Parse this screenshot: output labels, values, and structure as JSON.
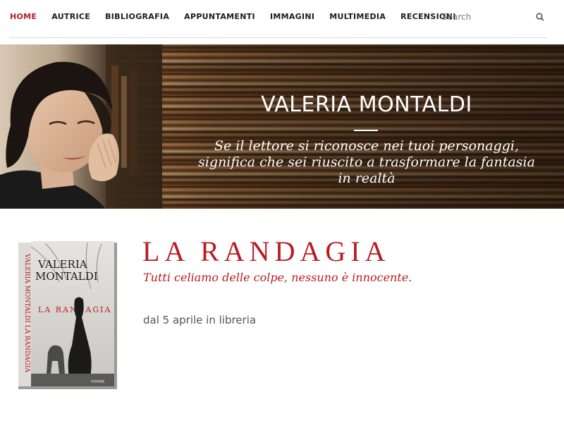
{
  "nav": {
    "items": [
      {
        "label": "HOME",
        "active": true
      },
      {
        "label": "AUTRICE",
        "active": false
      },
      {
        "label": "BIBLIOGRAFIA",
        "active": false
      },
      {
        "label": "APPUNTAMENTI",
        "active": false
      },
      {
        "label": "IMMAGINI",
        "active": false
      },
      {
        "label": "MULTIMEDIA",
        "active": false
      },
      {
        "label": "RECENSIONI",
        "active": false
      }
    ],
    "search": {
      "placeholder": "Search",
      "icon": "search-icon"
    }
  },
  "hero": {
    "title": "VALERIA MONTALDI",
    "quote_line1": "Se il lettore si riconosce nei tuoi personaggi,",
    "quote_line2": "significa che sei riuscito a trasformare la fantasia",
    "quote_line3": "in realtà"
  },
  "book": {
    "title": "LA RANDAGIA",
    "tagline": "Tutti celiamo delle colpe, nessuno è innocente.",
    "release": "dal 5 aprile in libreria",
    "cover": {
      "author": "VALERIA MONTALDI",
      "author_line1": "VALERIA",
      "author_line2": "MONTALDI",
      "title": "LA RANDAGIA",
      "spine": "VALERIA MONTALDI LA RANDAGIA"
    }
  },
  "colors": {
    "accent": "#b81c22",
    "nav_text": "#1c1c1c",
    "release_text": "#555555"
  }
}
